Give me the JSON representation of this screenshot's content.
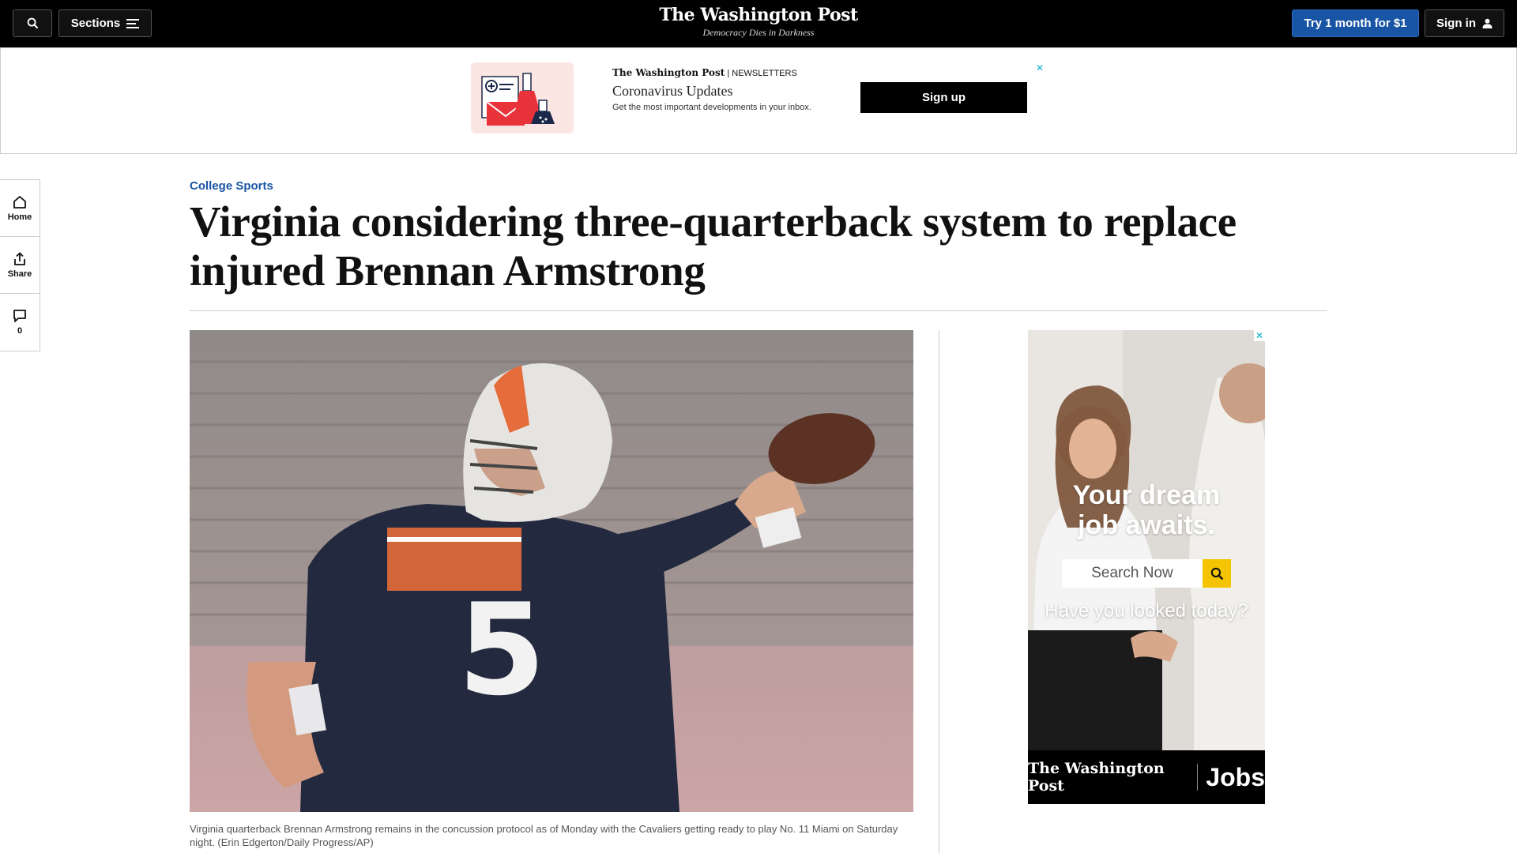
{
  "header": {
    "sections_label": "Sections",
    "brand": "The Washington Post",
    "tagline": "Democracy Dies in Darkness",
    "try_label": "Try 1 month for $1",
    "signin_label": "Sign in"
  },
  "newsletter_banner": {
    "brand": "The Washington Post",
    "brand_suffix": "| NEWSLETTERS",
    "title": "Coronavirus Updates",
    "description": "Get the most important developments in your inbox.",
    "signup_label": "Sign up"
  },
  "rail": {
    "home_label": "Home",
    "share_label": "Share",
    "comments_count": "0"
  },
  "article": {
    "kicker": "College Sports",
    "headline": "Virginia considering three-quarterback system to replace injured Brennan Armstrong",
    "photo_jersey_number": "5",
    "caption": "Virginia quarterback Brennan Armstrong remains in the concussion protocol as of Monday with the Cavaliers getting ready to play No. 11 Miami on Saturday night. (Erin Edgerton/Daily Progress/AP)"
  },
  "side_ad": {
    "headline_line1": "Your dream",
    "headline_line2": "job awaits.",
    "search_placeholder": "Search Now",
    "subline": "Have you looked today?",
    "footer_brand": "The Washington Post",
    "footer_product": "Jobs"
  },
  "colors": {
    "brand_blue": "#1955a5",
    "ad_close": "#00aecd",
    "ad_search_button": "#f5c400"
  },
  "icons": [
    "search-icon",
    "menu-icon",
    "user-icon",
    "home-icon",
    "share-icon",
    "comment-icon",
    "close-icon"
  ]
}
